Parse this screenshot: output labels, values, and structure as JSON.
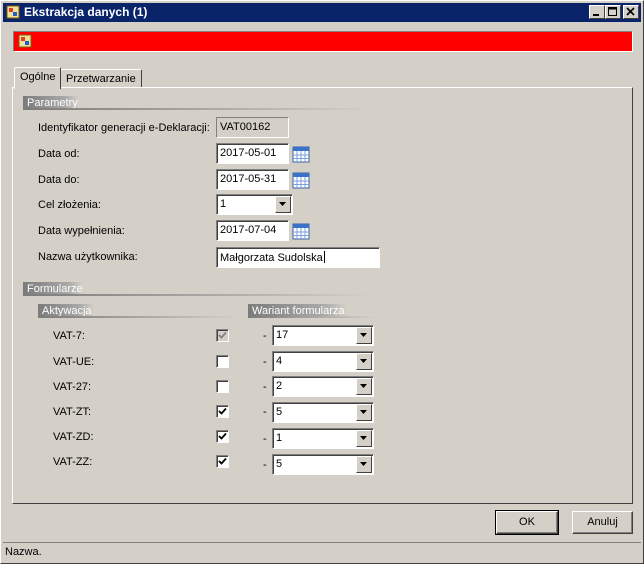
{
  "window": {
    "title": "Ekstrakcja danych (1)",
    "icon": "app-icon",
    "controls": [
      "minimize-icon",
      "maximize-icon",
      "close-icon"
    ]
  },
  "banner": {
    "color": "#ff0000",
    "icon": "app-icon"
  },
  "tabs": [
    {
      "label": "Ogólne",
      "active": true
    },
    {
      "label": "Przetwarzanie",
      "active": false
    }
  ],
  "parametry": {
    "header": "Parametry",
    "id_label": "Identyfikator generacji e-Deklaracji:",
    "id_value": "VAT00162",
    "data_od_label": "Data od:",
    "data_od_value": "2017-05-01",
    "data_do_label": "Data do:",
    "data_do_value": "2017-05-31",
    "cel_label": "Cel złożenia:",
    "cel_value": "1",
    "data_wyp_label": "Data wypełnienia:",
    "data_wyp_value": "2017-07-04",
    "user_label": "Nazwa użytkownika:",
    "user_value": "Małgorzata Sudolska"
  },
  "formularze": {
    "header": "Formularze",
    "col_activation": "Aktywacja",
    "col_variant": "Wariant formularza",
    "dash": "-",
    "rows": [
      {
        "name": "VAT-7:",
        "checked": true,
        "disabled": true,
        "variant": "17"
      },
      {
        "name": "VAT-UE:",
        "checked": false,
        "disabled": false,
        "variant": "4"
      },
      {
        "name": "VAT-27:",
        "checked": false,
        "disabled": false,
        "variant": "2"
      },
      {
        "name": "VAT-ZT:",
        "checked": true,
        "disabled": false,
        "variant": "5"
      },
      {
        "name": "VAT-ZD:",
        "checked": true,
        "disabled": false,
        "variant": "1"
      },
      {
        "name": "VAT-ZZ:",
        "checked": true,
        "disabled": false,
        "variant": "5"
      }
    ]
  },
  "buttons": {
    "ok": "OK",
    "cancel": "Anuluj"
  },
  "status": "Nazwa.",
  "colors": {
    "titlebar": "#0a246a",
    "face": "#d4d0c8",
    "banner": "#ff0000"
  }
}
